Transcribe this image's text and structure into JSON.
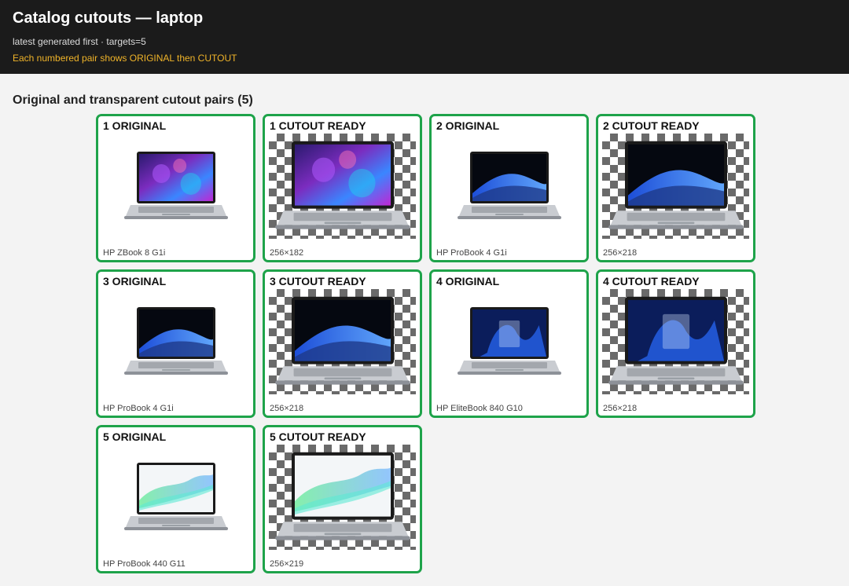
{
  "header": {
    "title": "Catalog cutouts — laptop",
    "subtitle": "latest generated first · targets=5",
    "note": "Each numbered pair shows ORIGINAL then CUTOUT"
  },
  "section": {
    "title": "Original and transparent cutout pairs (5)"
  },
  "cards": [
    {
      "label": "1 ORIGINAL",
      "caption": "HP ZBook 8 G1i",
      "kind": "original",
      "screen": "purple",
      "icon": "laptop-icon"
    },
    {
      "label": "1 CUTOUT READY",
      "caption": "256×182",
      "kind": "cutout",
      "screen": "purple",
      "icon": "laptop-icon"
    },
    {
      "label": "2 ORIGINAL",
      "caption": "HP ProBook 4 G1i",
      "kind": "original",
      "screen": "blue-wave",
      "icon": "laptop-icon"
    },
    {
      "label": "2 CUTOUT READY",
      "caption": "256×218",
      "kind": "cutout",
      "screen": "blue-wave",
      "icon": "laptop-icon"
    },
    {
      "label": "3 ORIGINAL",
      "caption": "HP ProBook 4 G1i",
      "kind": "original",
      "screen": "blue-wave",
      "icon": "laptop-icon"
    },
    {
      "label": "3 CUTOUT READY",
      "caption": "256×218",
      "kind": "cutout",
      "screen": "blue-wave",
      "icon": "laptop-icon"
    },
    {
      "label": "4 ORIGINAL",
      "caption": "HP EliteBook 840 G10",
      "kind": "original",
      "screen": "win11",
      "icon": "laptop-icon"
    },
    {
      "label": "4 CUTOUT READY",
      "caption": "256×218",
      "kind": "cutout",
      "screen": "win11",
      "icon": "laptop-icon"
    },
    {
      "label": "5 ORIGINAL",
      "caption": "HP ProBook 440 G11",
      "kind": "original",
      "screen": "green-wave",
      "icon": "laptop-icon"
    },
    {
      "label": "5 CUTOUT READY",
      "caption": "256×219",
      "kind": "cutout",
      "screen": "green-wave",
      "icon": "laptop-icon"
    }
  ],
  "colors": {
    "card_border": "#1ea34a",
    "header_bg": "#1b1b1b",
    "note": "#f0b429"
  }
}
